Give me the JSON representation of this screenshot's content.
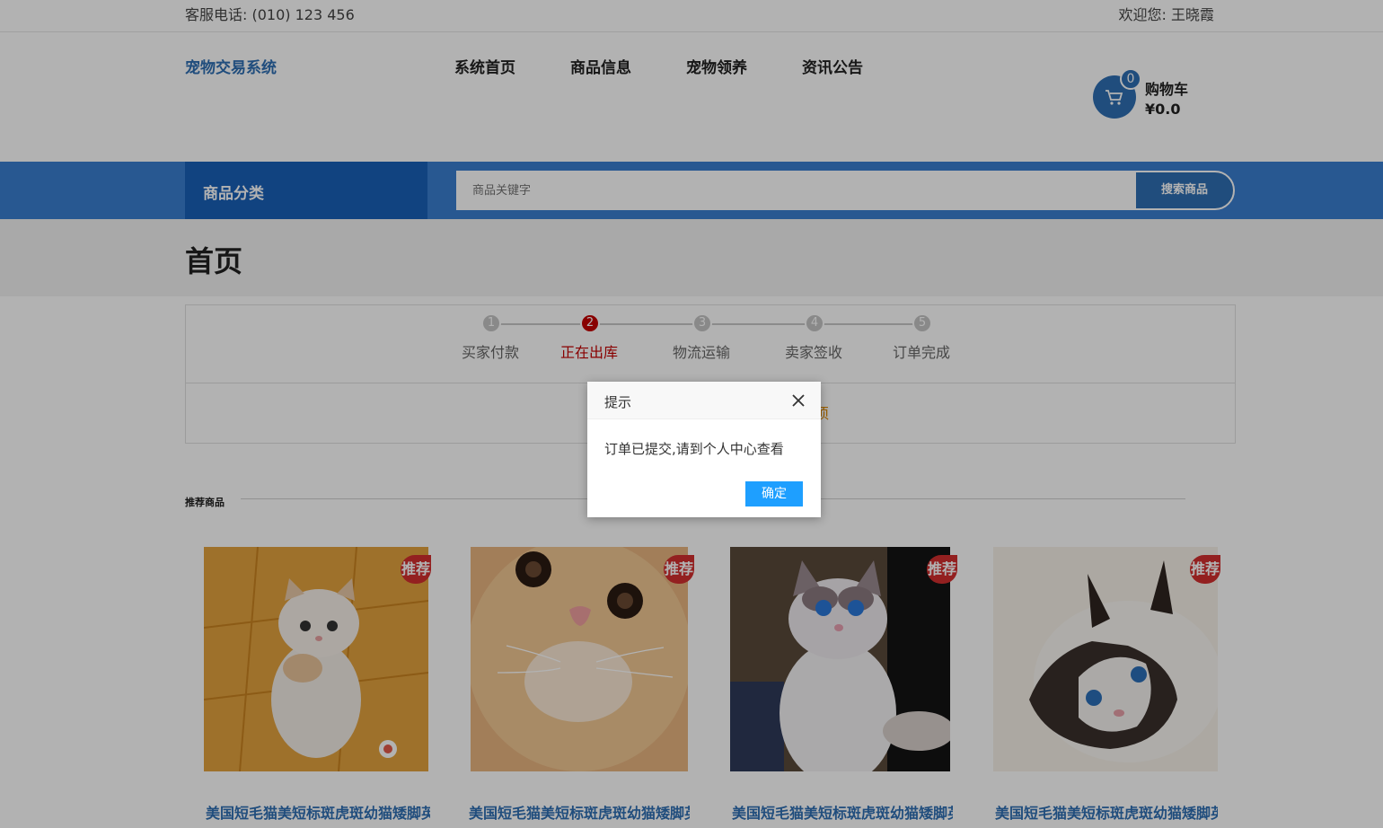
{
  "topbar": {
    "phone": "客服电话: (010) 123 456",
    "welcome": "欢迎您: 王晓霞"
  },
  "header": {
    "logo": "宠物交易系统",
    "nav": [
      "系统首页",
      "商品信息",
      "宠物领养",
      "资讯公告"
    ],
    "cart": {
      "count": "0",
      "label": "购物车",
      "total": "¥0.0"
    }
  },
  "searchbar": {
    "category": "商品分类",
    "placeholder": "商品关键字",
    "button": "搜索商品"
  },
  "page": {
    "title": "首页"
  },
  "order_steps": {
    "steps": [
      {
        "num": "1",
        "label": "买家付款"
      },
      {
        "num": "2",
        "label": "正在出库"
      },
      {
        "num": "3",
        "label": "物流运输"
      },
      {
        "num": "4",
        "label": "卖家签收"
      },
      {
        "num": "5",
        "label": "订单完成"
      }
    ],
    "active_step": 2,
    "hint_fragment": "须"
  },
  "recommended": {
    "title": "推荐商品",
    "badge": "推荐",
    "products": [
      {
        "name": "美国短毛猫美短标斑虎斑幼猫矮脚英"
      },
      {
        "name": "美国短毛猫美短标斑虎斑幼猫矮脚英"
      },
      {
        "name": "美国短毛猫美短标斑虎斑幼猫矮脚英"
      },
      {
        "name": "美国短毛猫美短标斑虎斑幼猫矮脚英"
      }
    ]
  },
  "dialog": {
    "title": "提示",
    "message": "订单已提交,请到个人中心查看",
    "ok": "确定"
  },
  "colors": {
    "brand_blue": "#2f6fb3",
    "nav_dark_blue": "#1960b8",
    "active_red": "#c40000",
    "badge_red": "#d32f2f",
    "dialog_button": "#1e9fff"
  }
}
